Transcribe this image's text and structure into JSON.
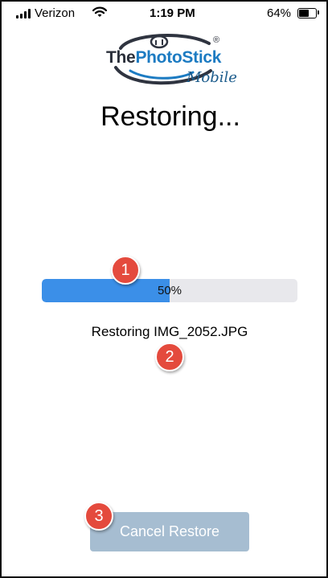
{
  "status_bar": {
    "carrier": "Verizon",
    "time": "1:19 PM",
    "battery_percent": "64%",
    "battery_level": 0.64,
    "signal_bars": 4
  },
  "logo": {
    "the": "The",
    "photostick": "PhotoStick",
    "registered": "®",
    "mobile": "Mobile"
  },
  "page_title": "Restoring...",
  "progress": {
    "value": 0.5,
    "label": "50%",
    "fill_color": "#3b8fe8",
    "track_color": "#e8e8ec"
  },
  "file_status": "Restoring IMG_2052.JPG",
  "cancel_button": {
    "label": "Cancel Restore",
    "color": "#a6bdd1"
  },
  "callouts": [
    "1",
    "2",
    "3"
  ],
  "colors": {
    "callout": "#e44a3d",
    "brand_blue": "#1c7bc2"
  }
}
